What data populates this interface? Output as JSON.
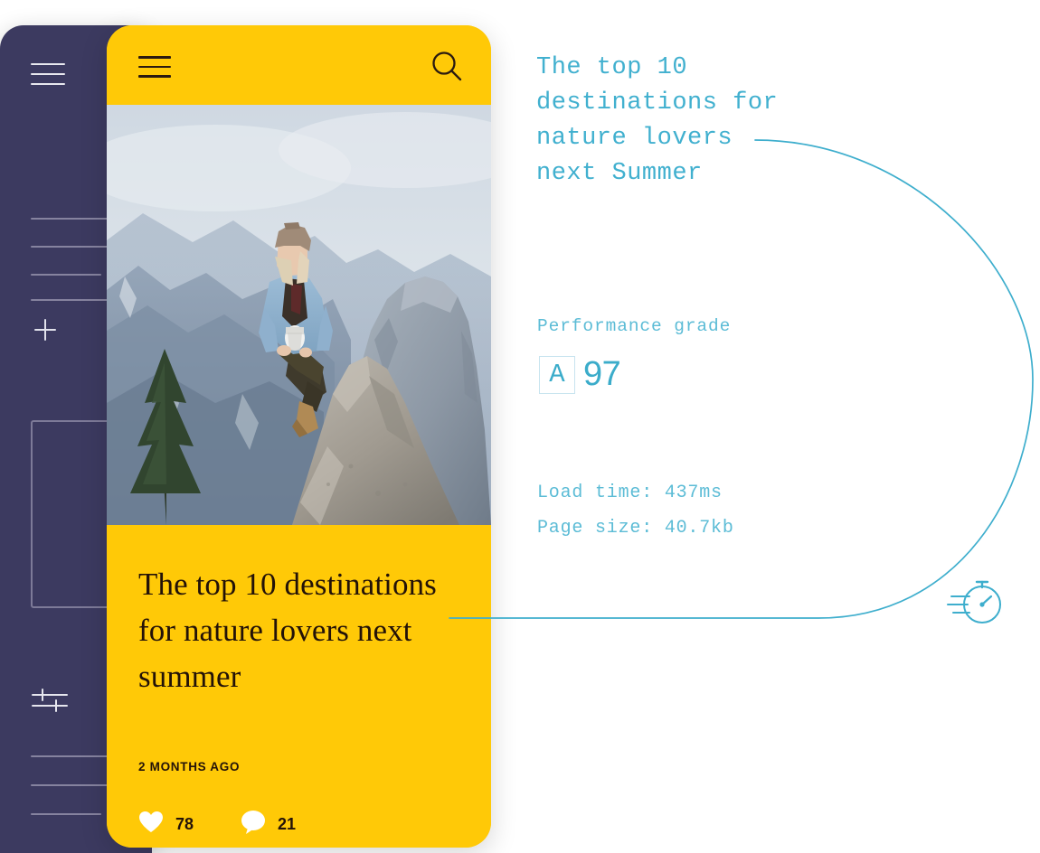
{
  "colors": {
    "accent_teal": "#41b0cf",
    "accent_teal_light": "#5cbcd6",
    "card_yellow": "#ffc907",
    "sidebar_navy": "#3c3a60",
    "text_dark": "#231208",
    "grade_box_border": "#c8e4ef"
  },
  "sidebar": {
    "menu_icon": "hamburger-menu-icon",
    "add_icon": "plus-icon",
    "filters_icon": "sliders-icon",
    "placeholder_lines": 7,
    "card_placeholder": "rectangle-outline"
  },
  "phone": {
    "header": {
      "menu_icon": "hamburger-menu-icon",
      "search_icon": "search-icon"
    },
    "photo": {
      "alt": "person in denim jacket and beanie sitting on granite rock with mountain peak behind"
    },
    "article": {
      "title": "The top 10 destinations for nature lovers next summer",
      "date": "2 MONTHS AGO",
      "likes": "78",
      "comments": "21",
      "like_icon": "heart-icon",
      "comment_icon": "speech-bubble-icon"
    }
  },
  "analytics": {
    "headline": "The top 10 destinations for nature lovers next Summer",
    "grade_label": "Performance grade",
    "grade_letter": "A",
    "grade_score": "97",
    "load_time": "Load time: 437ms",
    "page_size": "Page size: 40.7kb",
    "speed_icon": "stopwatch-icon"
  }
}
